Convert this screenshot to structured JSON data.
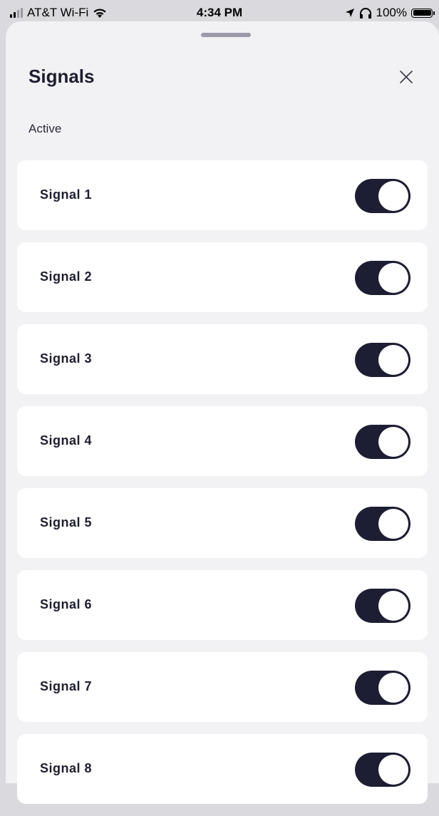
{
  "status_bar": {
    "carrier": "AT&T Wi-Fi",
    "time": "4:34 PM",
    "battery": "100%",
    "icons": [
      "cellular-signal-icon",
      "wifi-icon",
      "location-arrow-icon",
      "headphones-icon",
      "battery-icon"
    ]
  },
  "sheet": {
    "title": "Signals",
    "close_icon": "close-icon",
    "section_label": "Active"
  },
  "signals": [
    {
      "label": "Signal 1",
      "enabled": true
    },
    {
      "label": "Signal 2",
      "enabled": true
    },
    {
      "label": "Signal 3",
      "enabled": true
    },
    {
      "label": "Signal 4",
      "enabled": true
    },
    {
      "label": "Signal 5",
      "enabled": true
    },
    {
      "label": "Signal 6",
      "enabled": true
    },
    {
      "label": "Signal 7",
      "enabled": true
    },
    {
      "label": "Signal 8",
      "enabled": true
    }
  ],
  "colors": {
    "toggle_on": "#1d1d33",
    "sheet_background": "#f2f2f5",
    "row_background": "#ffffff",
    "text_primary": "#1e1e30"
  }
}
